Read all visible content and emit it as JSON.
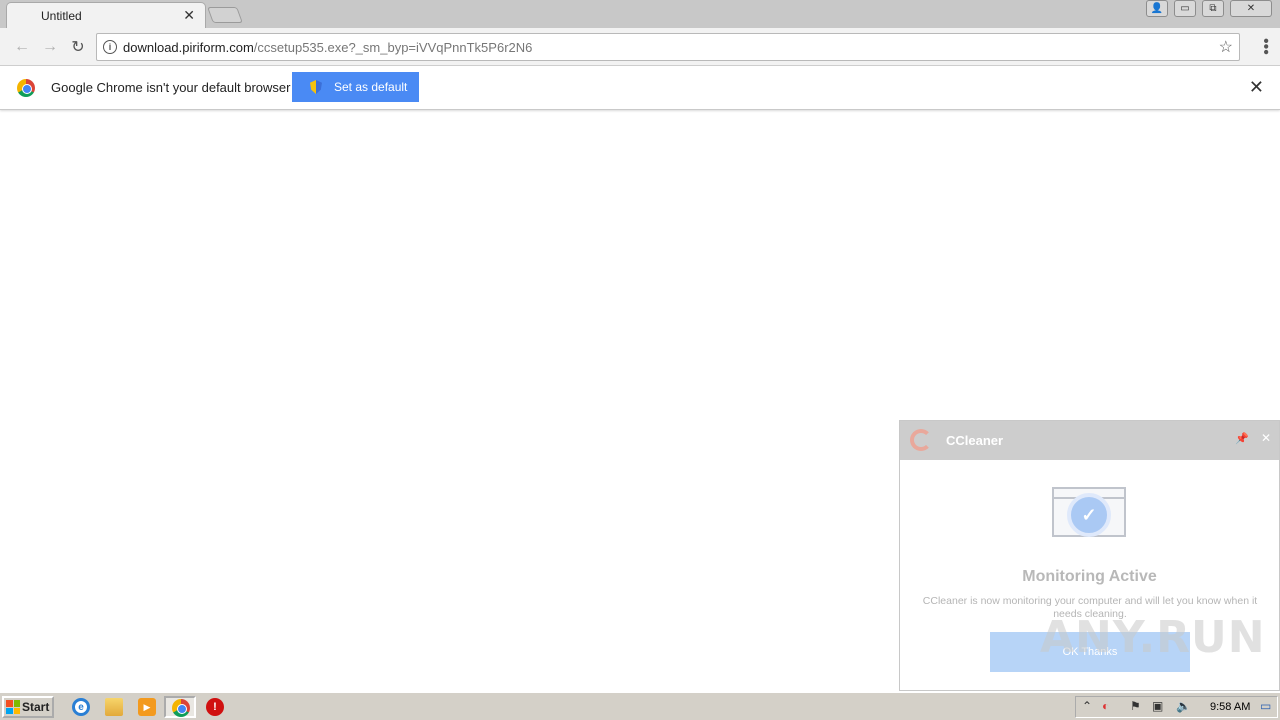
{
  "browser": {
    "tab_title": "Untitled",
    "tab_close": "✕",
    "url_host": "download.piriform.com",
    "url_path": "/ccsetup535.exe?_sm_byp=iVVqPnnTk5P6r2N6",
    "star": "☆",
    "window_buttons": {
      "user": "👤",
      "minimize": "▭",
      "restore": "⧉",
      "close": "✕"
    }
  },
  "infobar": {
    "message": "Google Chrome isn't your default browser",
    "button": "Set as default",
    "close": "✕"
  },
  "ccleaner": {
    "title": "CCleaner",
    "heading": "Monitoring Active",
    "text": "CCleaner is now monitoring your computer and will let you know when it needs cleaning.",
    "ok_button": "OK Thanks",
    "pin": "📌",
    "close": "✕",
    "check": "✓"
  },
  "watermark": "ANY.RUN",
  "taskbar": {
    "start": "Start",
    "clock": "9:58 AM",
    "ie_label": "e",
    "media_label": "▶",
    "stop_label": "!"
  },
  "colors": {
    "accent": "#4a8af4",
    "taskbar": "#d4d0c8"
  }
}
